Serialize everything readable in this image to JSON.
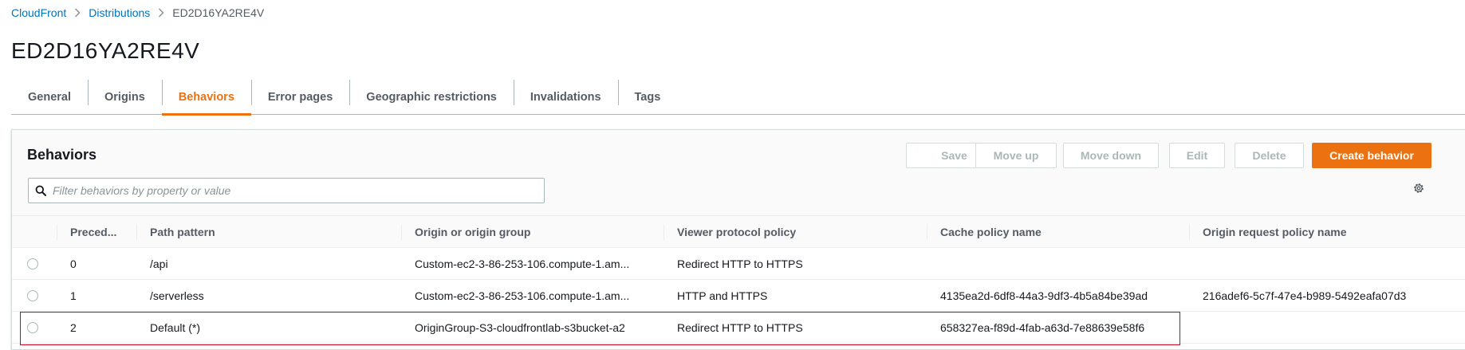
{
  "breadcrumb": {
    "items": [
      "CloudFront",
      "Distributions",
      "ED2D16YA2RE4V"
    ]
  },
  "page": {
    "title": "ED2D16YA2RE4V"
  },
  "tabs": [
    {
      "label": "General"
    },
    {
      "label": "Origins"
    },
    {
      "label": "Behaviors",
      "active": true
    },
    {
      "label": "Error pages"
    },
    {
      "label": "Geographic restrictions"
    },
    {
      "label": "Invalidations"
    },
    {
      "label": "Tags"
    }
  ],
  "panel": {
    "title": "Behaviors",
    "buttons": {
      "save": "Save",
      "move_up": "Move up",
      "move_down": "Move down",
      "edit": "Edit",
      "delete": "Delete",
      "create": "Create behavior"
    },
    "filter_placeholder": "Filter behaviors by property or value"
  },
  "table": {
    "columns": [
      "Preced...",
      "Path pattern",
      "Origin or origin group",
      "Viewer protocol policy",
      "Cache policy name",
      "Origin request policy name"
    ],
    "rows": [
      {
        "precedence": "0",
        "path": "/api",
        "origin": "Custom-ec2-3-86-253-106.compute-1.am...",
        "viewer": "Redirect HTTP to HTTPS",
        "cache": "",
        "origin_request": ""
      },
      {
        "precedence": "1",
        "path": "/serverless",
        "origin": "Custom-ec2-3-86-253-106.compute-1.am...",
        "viewer": "HTTP and HTTPS",
        "cache": "4135ea2d-6df8-44a3-9df3-4b5a84be39ad",
        "origin_request": "216adef6-5c7f-47e4-b989-5492eafa07d3"
      },
      {
        "precedence": "2",
        "path": "Default (*)",
        "origin": "OriginGroup-S3-cloudfrontlab-s3bucket-a2",
        "viewer": "Redirect HTTP to HTTPS",
        "cache": "658327ea-f89d-4fab-a63d-7e88639e58f6",
        "origin_request": ""
      }
    ]
  },
  "colors": {
    "accent": "#ec7211",
    "link": "#0073bb",
    "highlight": "#d0021b"
  }
}
